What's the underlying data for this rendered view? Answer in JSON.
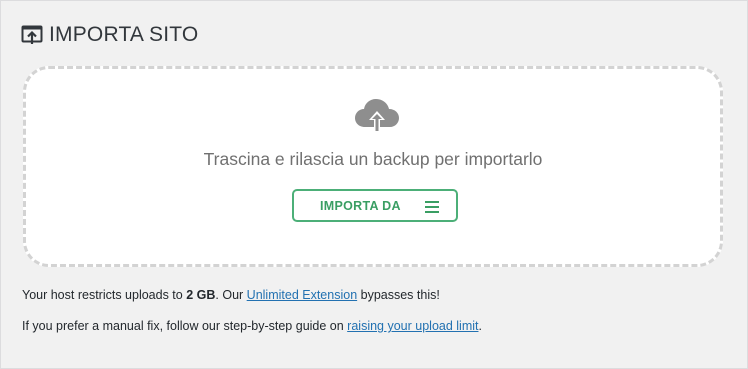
{
  "header": {
    "title": "IMPORTA SITO",
    "icon": "import-upload-icon"
  },
  "dropzone": {
    "icon": "cloud-upload-icon",
    "text": "Trascina e rilascia un backup per importarlo",
    "button_label": "IMPORTA DA",
    "button_icon": "menu-icon"
  },
  "info": {
    "line1_prefix": "Your host restricts uploads to ",
    "line1_limit": "2 GB",
    "line1_mid": ". Our ",
    "line1_link": "Unlimited Extension",
    "line1_suffix": " bypasses this!",
    "line2_prefix": "If you prefer a manual fix, follow our step-by-step guide on ",
    "line2_link": "raising your upload limit",
    "line2_suffix": "."
  },
  "colors": {
    "accent": "#3a9e63",
    "link": "#2271b1",
    "dropzone_border": "#d3d3d3",
    "text_muted": "#707070"
  }
}
